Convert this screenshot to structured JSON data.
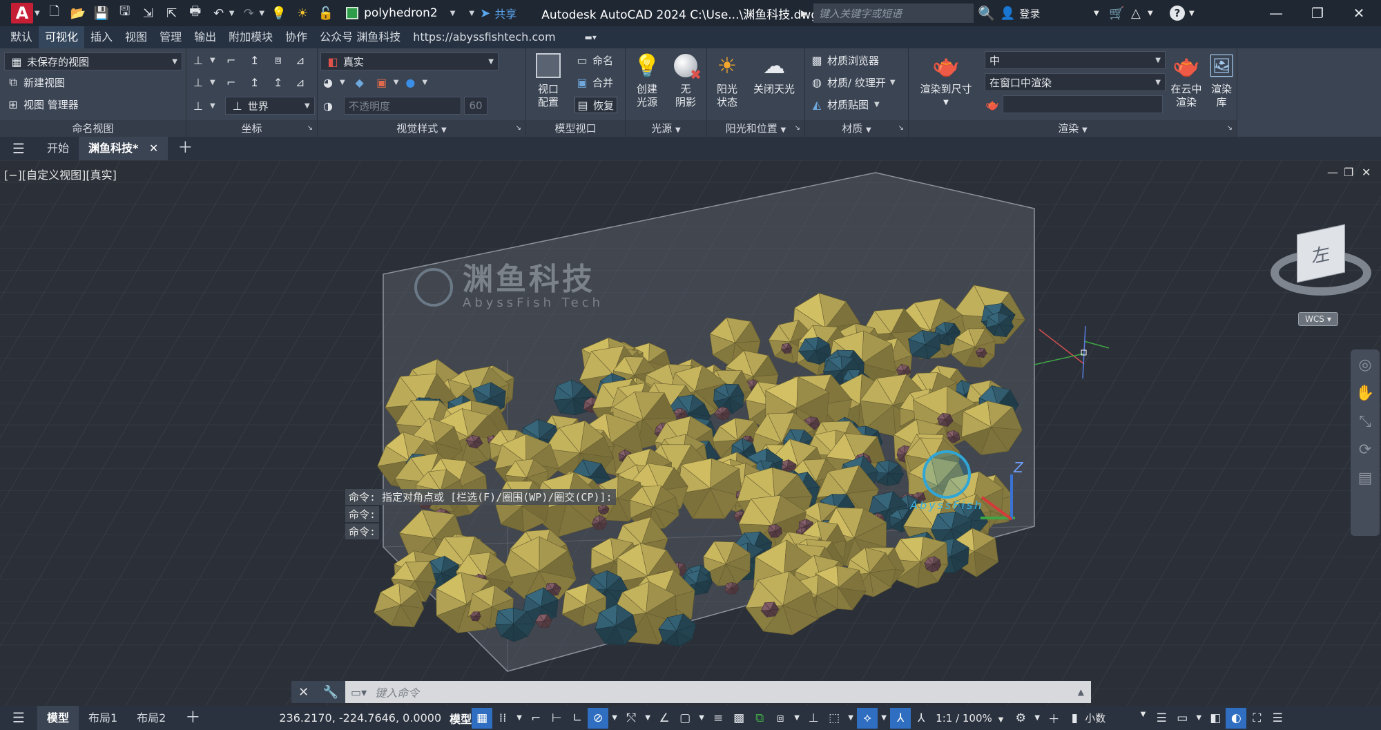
{
  "titlebar": {
    "logo": "A",
    "workspace": "polyhedron2",
    "share": "共享",
    "title": "Autodesk AutoCAD 2024    C:\\Use...\\渊鱼科技.dwg",
    "search_placeholder": "键入关键字或短语",
    "login": "登录",
    "help": "?"
  },
  "menu_tabs": [
    "默认",
    "可视化",
    "插入",
    "视图",
    "管理",
    "输出",
    "附加模块",
    "协作",
    "公众号 渊鱼科技",
    "https://abyssfishtech.com"
  ],
  "ribbon": {
    "named_views": {
      "current": "未保存的视图",
      "new_view": "新建视图",
      "view_manager": "视图 管理器",
      "label": "命名视图"
    },
    "coordinates": {
      "ucs": "世界",
      "label": "坐标"
    },
    "visual_styles": {
      "style": "真实",
      "opacity_placeholder": "不透明度",
      "opacity_value": "60",
      "label": "视觉样式"
    },
    "model_viewports": {
      "config_line1": "视口",
      "config_line2": "配置",
      "name": "命名",
      "join": "合并",
      "restore": "恢复",
      "label": "模型视口"
    },
    "lights": {
      "create_line1": "创建",
      "create_line2": "光源",
      "shadow_line1": "无",
      "shadow_line2": "阴影",
      "label": "光源"
    },
    "sun": {
      "status_line1": "阳光",
      "status_line2": "状态",
      "sky_off": "关闭天光",
      "label": "阳光和位置"
    },
    "materials": {
      "browser": "材质浏览器",
      "texture": "材质/ 纹理开",
      "mapping": "材质贴图",
      "label": "材质"
    },
    "render": {
      "render_to_size": "渲染到尺寸",
      "quality": "中",
      "mode": "在窗口中渲染",
      "cloud_line1": "在云中",
      "cloud_line2": "渲染",
      "library_line1": "渲染",
      "library_line2": "库",
      "label": "渲染"
    }
  },
  "doc_tabs": {
    "start": "开始",
    "active": "渊鱼科技*"
  },
  "viewport": {
    "label": "[−][自定义视图][真实]",
    "watermark_cn": "渊鱼科技",
    "watermark_en": "AbyssFish Tech",
    "logo_text": "AbyssFish",
    "viewcube_face": "左",
    "wcs": "WCS",
    "axis_z": "Z",
    "history": [
      "命令: 指定对角点或 [栏选(F)/圈围(WP)/圈交(CP)]:",
      "命令:",
      "命令:"
    ]
  },
  "cmdline": {
    "placeholder": "键入命令"
  },
  "statusbar": {
    "model_tab": "模型",
    "layout1": "布局1",
    "layout2": "布局2",
    "coords": "236.2170, -224.7646, 0.0000",
    "space": "模型",
    "scale": "1:1 / 100%",
    "units": "小数"
  },
  "colors": {
    "accent": "#2f6ec0",
    "logo": "#c61f35",
    "polyhedron_gold": "#a99a50",
    "polyhedron_blue": "#2e5566",
    "polyhedron_mauve": "#6e4f57"
  }
}
